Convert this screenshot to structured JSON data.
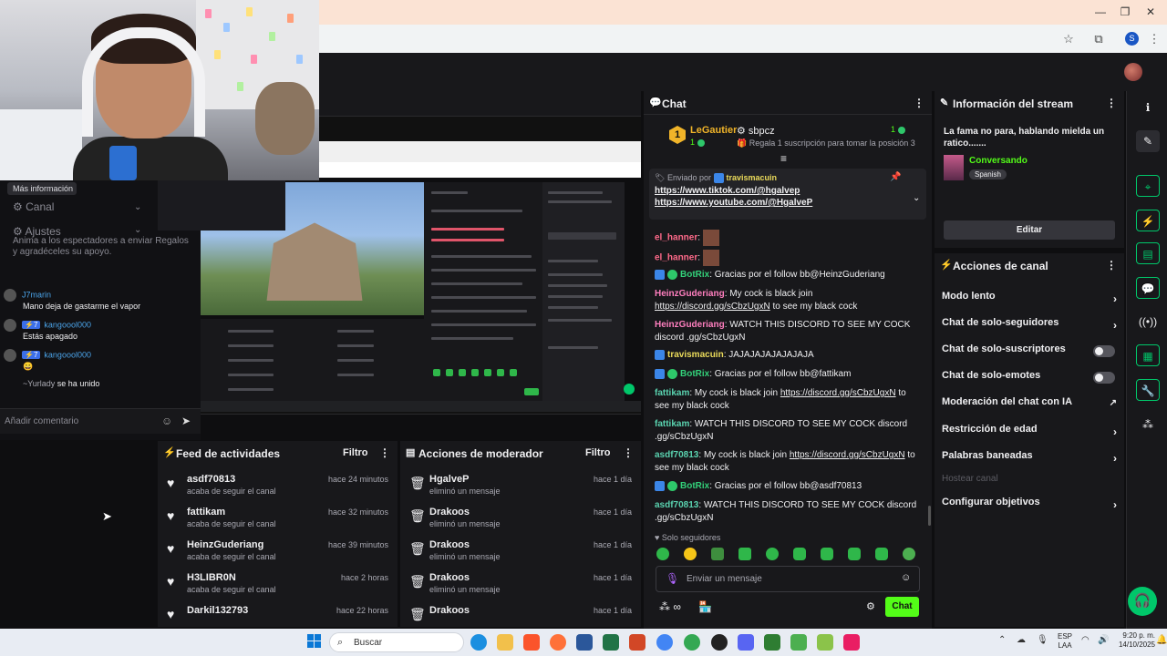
{
  "browser": {
    "minimize": "—",
    "restore": "❐",
    "close": "✕",
    "profile_initial": "S"
  },
  "left_panel": {
    "more_info": "Más información",
    "canal": "Canal",
    "ajustes": "Ajustes",
    "hint": "Anima a los espectadores a enviar Regalos y agradéceles su apoyo.",
    "messages": [
      {
        "user": "J7marin",
        "text": "Mano deja de gastarme el vapor"
      },
      {
        "badge": "7",
        "user": "kangoool000",
        "text": "Estás apagado"
      },
      {
        "badge": "7",
        "user": "kangoool000",
        "text": ""
      },
      {
        "user": "~Yurlady",
        "text": "se ha unido"
      }
    ],
    "comment_placeholder": "Añadir comentario"
  },
  "feed": {
    "title": "Feed de actividades",
    "filter": "Filtro",
    "items": [
      {
        "name": "asdf70813",
        "sub": "acaba de seguir el canal",
        "time": "hace 24 minutos"
      },
      {
        "name": "fattikam",
        "sub": "acaba de seguir el canal",
        "time": "hace 32 minutos"
      },
      {
        "name": "HeinzGuderiang",
        "sub": "acaba de seguir el canal",
        "time": "hace 39 minutos"
      },
      {
        "name": "H3LIBR0N",
        "sub": "acaba de seguir el canal",
        "time": "hace 2 horas"
      },
      {
        "name": "Darkil132793",
        "sub": "",
        "time": "hace 22 horas"
      }
    ]
  },
  "mod": {
    "title": "Acciones de moderador",
    "filter": "Filtro",
    "items": [
      {
        "name": "HgalveP",
        "sub": "eliminó un mensaje",
        "time": "hace 1 día"
      },
      {
        "name": "Drakoos",
        "sub": "eliminó un mensaje",
        "time": "hace 1 día"
      },
      {
        "name": "Drakoos",
        "sub": "eliminó un mensaje",
        "time": "hace 1 día"
      },
      {
        "name": "Drakoos",
        "sub": "eliminó un mensaje",
        "time": "hace 1 día"
      },
      {
        "name": "Drakoos",
        "sub": "",
        "time": "hace 1 día"
      }
    ]
  },
  "chat": {
    "title": "Chat",
    "leader": {
      "rank": "1",
      "name": "LeGautier",
      "count": "1",
      "second": "sbpcz",
      "second_count": "1",
      "second_text": "Regala 1 suscripción para tomar la posición 3"
    },
    "pinned": {
      "sent_by": "Enviado por",
      "user": "travismacuin",
      "link1": "https://www.tiktok.com/@hgalvep",
      "link2": "https://www.youtube.com/@HgalveP"
    },
    "messages": [
      {
        "user": "el_hanner",
        "text": ":",
        "emote": true
      },
      {
        "user": "el_hanner",
        "text": ":",
        "emote": true
      },
      {
        "user": "BotRix",
        "text": "Gracias por el follow bb@HeinzGuderiang"
      },
      {
        "user": "HeinzGuderiang",
        "text": "My cock is black join",
        "link": "https://discord.gg/sCbzUgxN",
        "tail": "to see my black cock"
      },
      {
        "user": "HeinzGuderiang",
        "text": "WATCH THIS DISCORD TO SEE MY COCK discord .gg/sCbzUgxN"
      },
      {
        "user": "travismacuin",
        "text": "JAJAJAJAJAJAJAJA"
      },
      {
        "user": "BotRix",
        "text": "Gracias por el follow bb@fattikam"
      },
      {
        "user": "fattikam",
        "text": "My cock is black join",
        "link": "https://discord.gg/sCbzUgxN",
        "tail": "to see my black cock"
      },
      {
        "user": "fattikam",
        "text": "WATCH THIS DISCORD TO SEE MY COCK discord .gg/sCbzUgxN"
      },
      {
        "user": "asdf70813",
        "text": "My cock is black join",
        "link": "https://discord.gg/sCbzUgxN",
        "tail": "to see my black cock"
      },
      {
        "user": "BotRix",
        "text": "Gracias por el follow bb@asdf70813"
      },
      {
        "user": "asdf70813",
        "text": "WATCH THIS DISCORD TO SEE MY COCK discord .gg/sCbzUgxN"
      }
    ],
    "followers_only": "Solo seguidores",
    "input_placeholder": "Enviar un mensaje",
    "send": "Chat"
  },
  "stream_info": {
    "title": "Información del stream",
    "stream_title": "La fama no para, hablando mielda un ratico.......",
    "category": "Conversando",
    "language": "Spanish",
    "edit": "Editar"
  },
  "channel_actions": {
    "title": "Acciones de canal",
    "items": [
      {
        "label": "Modo lento",
        "control": "arrow"
      },
      {
        "label": "Chat de solo-seguidores",
        "control": "arrow"
      },
      {
        "label": "Chat de solo-suscriptores",
        "control": "toggle"
      },
      {
        "label": "Chat de solo-emotes",
        "control": "toggle"
      },
      {
        "label": "Moderación del chat con IA",
        "control": "external"
      },
      {
        "label": "Restricción de edad",
        "control": "arrow"
      },
      {
        "label": "Palabras baneadas",
        "control": "arrow"
      },
      {
        "label": "Hostear canal",
        "control": "none"
      },
      {
        "label": "Configurar objetivos",
        "control": "arrow"
      }
    ]
  },
  "taskbar": {
    "search": "Buscar",
    "lang": "ESP",
    "lang2": "LAA",
    "time": "9:20 p. m.",
    "date": "14/10/2025"
  },
  "colors": {
    "accent": "#53fc18",
    "link": "#efeff1",
    "panel": "#18181b"
  }
}
